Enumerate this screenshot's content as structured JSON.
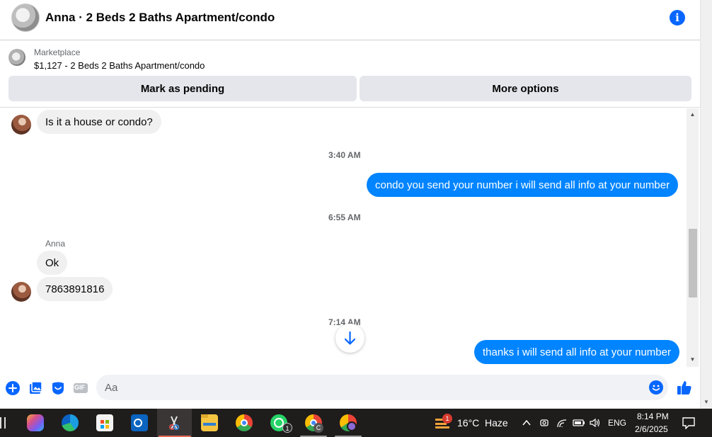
{
  "header": {
    "title": "Anna · 2 Beds 2 Baths Apartment/condo",
    "avatar_icon": "listing-photo",
    "info_icon": "info-icon",
    "info_glyph": "i"
  },
  "listing": {
    "source": "Marketplace",
    "title": "$1,127 - 2 Beds 2 Baths Apartment/condo",
    "mark_pending_label": "Mark as pending",
    "more_options_label": "More options"
  },
  "messages": {
    "items": [
      {
        "type": "incoming",
        "text": "Is it a house or condo?"
      },
      {
        "type": "timestamp",
        "text": "3:40 AM"
      },
      {
        "type": "outgoing",
        "text": "condo you send your number i will send all info at your number"
      },
      {
        "type": "timestamp",
        "text": "6:55 AM"
      },
      {
        "type": "sender",
        "text": "Anna"
      },
      {
        "type": "incoming",
        "text": "Ok"
      },
      {
        "type": "incoming",
        "text": "7863891816"
      },
      {
        "type": "timestamp",
        "text": "7:14 AM"
      },
      {
        "type": "outgoing",
        "text": "thanks i will send all info at your number"
      }
    ]
  },
  "composer": {
    "placeholder": "Aa",
    "icons": [
      "add-icon",
      "photo-icon",
      "sticker-icon",
      "gif-icon",
      "emoji-icon",
      "like-icon"
    ],
    "gif_label": "GIF"
  },
  "taskbar": {
    "weather_temp": "16°C",
    "weather_desc": "Haze",
    "weather_badge": "1",
    "whatsapp_badge": "1",
    "chrome_profile_letter": "C",
    "language": "ENG",
    "time": "8:14 PM",
    "date": "2/6/2025"
  },
  "colors": {
    "accent": "#0866ff",
    "outgoing_bubble": "#0084ff",
    "incoming_bubble": "#f0f0f0",
    "taskbar": "#1f1c1c"
  }
}
